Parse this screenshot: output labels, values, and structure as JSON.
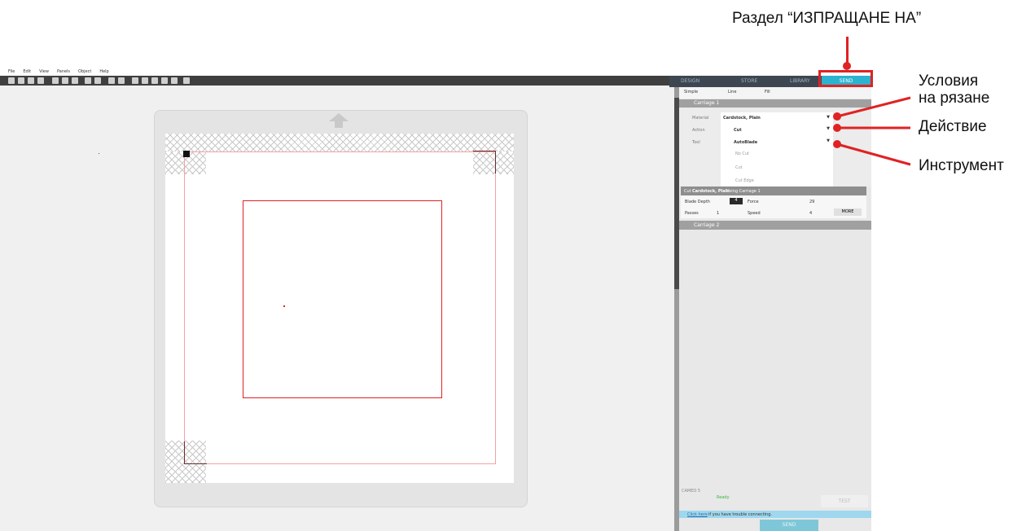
{
  "menu": [
    "File",
    "Edit",
    "View",
    "Panels",
    "Object",
    "Help"
  ],
  "nav": {
    "design": "DESIGN",
    "store": "STORE",
    "library": "LIBRARY",
    "send": "SEND"
  },
  "mode_tabs": [
    "Simple",
    "Line",
    "Fill"
  ],
  "carriage1": {
    "header": "Carriage 1",
    "material_label": "Material",
    "material_value": "Cardstock, Plain",
    "action_label": "Action",
    "action_value": "Cut",
    "tool_label": "Tool",
    "tool_value": "AutoBlade",
    "cut_options": [
      "No Cut",
      "Cut",
      "Cut Edge"
    ],
    "summary_prefix": "Cut",
    "summary_material": "Cardstock, Plain",
    "summary_suffix": "Using Carriage 1",
    "blade_depth_label": "Blade Depth",
    "blade_depth_value": "4",
    "force_label": "Force",
    "force_value": "29",
    "passes_label": "Passes",
    "passes_value": "1",
    "speed_label": "Speed",
    "speed_value": "4",
    "more_label": "MORE"
  },
  "carriage2": {
    "header": "Carriage 2"
  },
  "device": {
    "name": "CAMEO 5",
    "status": "Ready",
    "test_label": "TEST",
    "click_here": "Click here",
    "trouble_text": "if you have trouble connecting.",
    "send_label": "SEND"
  },
  "annotations": {
    "send_section": "Раздел “ИЗПРАЩАНЕ НА”",
    "cut_conditions_line1": "Условия",
    "cut_conditions_line2": "на рязане",
    "action": "Действие",
    "tool": "Инструмент"
  },
  "colors": {
    "accent": "#2bb3cf",
    "callout": "#e02222",
    "toolbar": "#3f3f3f"
  }
}
